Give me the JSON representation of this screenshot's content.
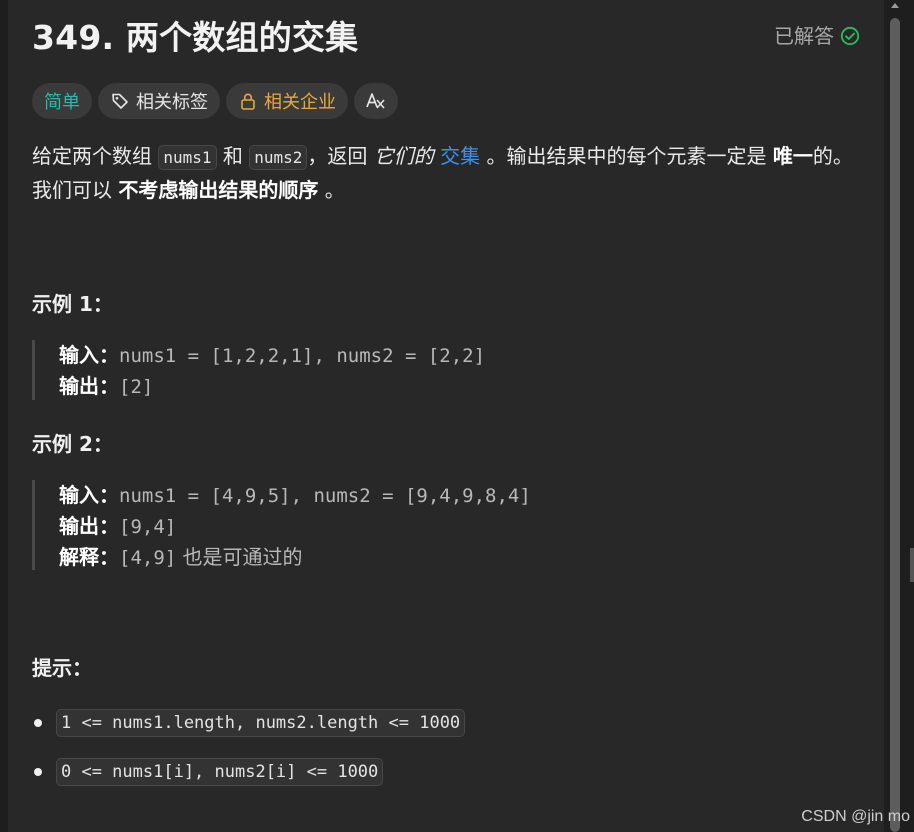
{
  "problem": {
    "title": "349. 两个数组的交集",
    "status_label": "已解答",
    "colors": {
      "easy": "#2bb8b0",
      "company": "#e8a93a",
      "solved_check": "#2cbb5d",
      "link": "#3b8ff5"
    }
  },
  "tags": {
    "difficulty": "简单",
    "related_tags": "相关标签",
    "related_companies": "相关企业"
  },
  "description": {
    "part1": "给定两个数组 ",
    "code1": "nums1",
    "part2": " 和 ",
    "code2": "nums2",
    "part3": "，返回 ",
    "em": "它们的",
    "space": " ",
    "link": "交集",
    "part4": " 。输出结果中的每个元素一定是 ",
    "strong1": "唯一",
    "part5": "的。我们可以 ",
    "strong2": "不考虑输出结果的顺序",
    "part6": " 。"
  },
  "examples": [
    {
      "title": "示例 1：",
      "input_label": "输入：",
      "input_value": "nums1 = [1,2,2,1], nums2 = [2,2]",
      "output_label": "输出：",
      "output_value": "[2]"
    },
    {
      "title": "示例 2：",
      "input_label": "输入：",
      "input_value": "nums1 = [4,9,5], nums2 = [9,4,9,8,4]",
      "output_label": "输出：",
      "output_value": "[9,4]",
      "explain_label": "解释：",
      "explain_value": "[4,9]",
      "explain_text": " 也是可通过的"
    }
  ],
  "hints": {
    "title": "提示：",
    "items": [
      "1 <= nums1.length, nums2.length <= 1000",
      "0 <= nums1[i], nums2[i] <= 1000"
    ]
  },
  "watermark": "CSDN @jin mo",
  "icons": {
    "solved": "check-circle-icon",
    "tag": "tag-icon",
    "company": "lock-icon",
    "translate": "translate-icon"
  }
}
